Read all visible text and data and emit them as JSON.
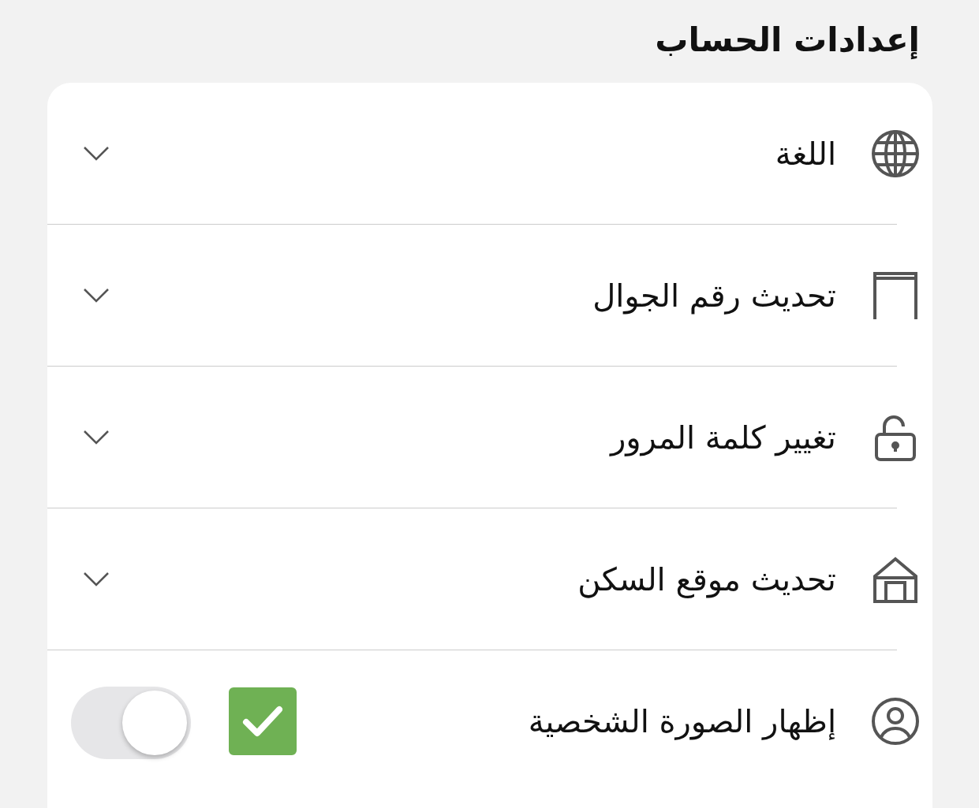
{
  "title": "إعدادات الحساب",
  "rows": [
    {
      "kind": "dropdown",
      "label": "اللغة",
      "expanded": false
    },
    {
      "kind": "dropdown",
      "label": "تحديث رقم الجوال",
      "expanded": false
    },
    {
      "kind": "dropdown",
      "label": "تغيير كلمة المرور",
      "expanded": false
    },
    {
      "kind": "dropdown",
      "label": "تحديث موقع السكن",
      "expanded": false
    },
    {
      "kind": "switch",
      "label": "إظهار الصورة الشخصية",
      "checked": true,
      "on": false
    }
  ]
}
